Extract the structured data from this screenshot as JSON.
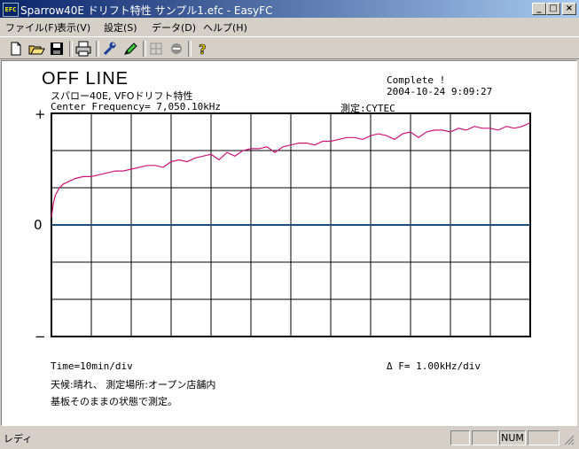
{
  "window": {
    "icon_text": "EFC",
    "title": "Sparrow40E  ドリフト特性  サンプル1.efc - EasyFC",
    "controls": {
      "minimize": "_",
      "maximize": "□",
      "close": "×"
    }
  },
  "menu": {
    "items": [
      "ファイル(F)",
      "表示(V)",
      "設定(S)",
      "データ(D)",
      "ヘルプ(H)"
    ]
  },
  "toolbar": {
    "buttons": [
      "new-icon",
      "open-icon",
      "save-icon",
      "print-icon",
      "wrench-icon",
      "marker-icon",
      "grid-icon",
      "stop-icon",
      "help-icon"
    ]
  },
  "report": {
    "status": "OFF LINE",
    "device": "スパロー40E, VFOドリフト特性",
    "center_frequency": "Center Frequency=  7,050.10kHz",
    "complete": "Complete !",
    "datetime": "2004-10-24  9:09:27",
    "measured_by": "測定:CYTEC",
    "y_plus": "+",
    "y_zero": "0",
    "y_minus": "−",
    "time_div": "Time=10min/div",
    "delta_f": "Δ F=    1.00kHz/div",
    "weather": "天候:晴れ、 測定場所:オープン店舗内",
    "note": "基板そのままの状態で測定。"
  },
  "chart_data": {
    "type": "line",
    "xlabel": "Time=10min/div",
    "ylabel": "Δ F=    1.00kHz/div",
    "x_unit": "min",
    "xlim": [
      0,
      120
    ],
    "ylim": [
      -3,
      3
    ],
    "series": [
      {
        "color": "#cc1477",
        "x": [
          0,
          0.5,
          1,
          2,
          3,
          4,
          5,
          6,
          8,
          10,
          12,
          14,
          16,
          18,
          20,
          22,
          24,
          26,
          28,
          30,
          32,
          34,
          36,
          38,
          40,
          42,
          44,
          46,
          48,
          50,
          52,
          54,
          56,
          58,
          60,
          62,
          64,
          66,
          68,
          70,
          72,
          74,
          76,
          78,
          80,
          82,
          84,
          86,
          88,
          90,
          92,
          94,
          96,
          98,
          100,
          102,
          104,
          106,
          108,
          110,
          112,
          114,
          116,
          118,
          120
        ],
        "y": [
          0.2,
          0.6,
          0.8,
          1.0,
          1.1,
          1.15,
          1.2,
          1.25,
          1.3,
          1.3,
          1.35,
          1.4,
          1.45,
          1.45,
          1.5,
          1.55,
          1.6,
          1.6,
          1.55,
          1.7,
          1.75,
          1.7,
          1.8,
          1.85,
          1.9,
          1.75,
          1.95,
          1.85,
          2.0,
          2.05,
          2.05,
          2.1,
          1.95,
          2.1,
          2.15,
          2.2,
          2.2,
          2.15,
          2.25,
          2.25,
          2.3,
          2.35,
          2.35,
          2.3,
          2.4,
          2.45,
          2.4,
          2.3,
          2.45,
          2.5,
          2.35,
          2.5,
          2.55,
          2.55,
          2.5,
          2.6,
          2.55,
          2.65,
          2.6,
          2.6,
          2.55,
          2.65,
          2.6,
          2.65,
          2.75
        ]
      }
    ],
    "zero_line_color": "#1f4e79",
    "grid": true,
    "grid_cols": 12,
    "grid_rows": 6
  },
  "statusbar": {
    "text": "レディ",
    "num": "NUM"
  }
}
